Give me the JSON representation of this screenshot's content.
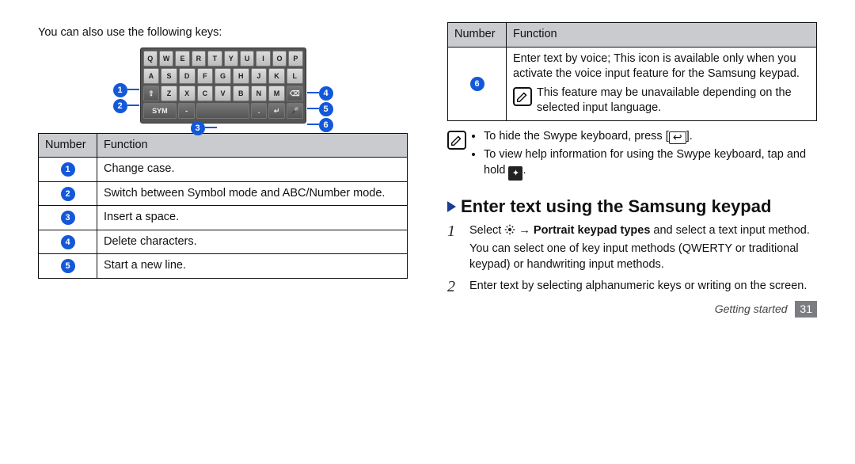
{
  "left": {
    "intro": "You can also use the following keys:",
    "callouts": {
      "n1": "1",
      "n2": "2",
      "n3": "3",
      "n4": "4",
      "n5": "5",
      "n6": "6"
    },
    "tbl_head_num": "Number",
    "tbl_head_fn": "Function",
    "rows": {
      "r1": "Change case.",
      "r2": "Switch between Symbol mode and ABC/Number mode.",
      "r3": "Insert a space.",
      "r4": "Delete characters.",
      "r5": "Start a new line."
    },
    "row_nums": {
      "r1": "1",
      "r2": "2",
      "r3": "3",
      "r4": "4",
      "r5": "5"
    }
  },
  "right": {
    "tbl_head_num": "Number",
    "tbl_head_fn": "Function",
    "row6_num": "6",
    "row6_main": "Enter text by voice; This icon is available only when you activate the voice input feature for the Samsung keypad.",
    "row6_note": "This feature may be unavailable depending on the selected input language.",
    "tip1_pre": "To hide the Swype keyboard, press [",
    "tip1_post": "].",
    "tip2_pre": "To view help information for using the Swype keyboard, tap and hold ",
    "tip2_post": ".",
    "section_title": "Enter text using the Samsung keypad",
    "step1_pre": "Select ",
    "step1_arrow": " → ",
    "step1_bold": "Portrait keypad types",
    "step1_post": " and select a text input method.",
    "step1_sub": "You can select one of key input methods (QWERTY or traditional keypad) or handwriting input methods.",
    "step2": "Enter text by selecting alphanumeric keys or writing on the screen.",
    "step_nums": {
      "s1": "1",
      "s2": "2"
    }
  },
  "footer": {
    "section": "Getting started",
    "page": "31"
  }
}
